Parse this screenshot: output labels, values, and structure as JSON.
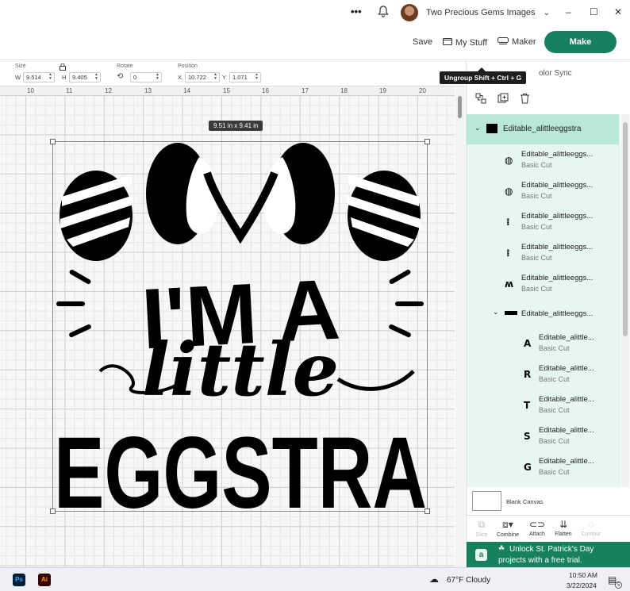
{
  "titlebar": {
    "user_name": "Two Precious Gems Images",
    "more_icon": "more-icon",
    "bell_icon": "bell-icon",
    "minimize": "–",
    "maximize": "☐",
    "close": "✕"
  },
  "header": {
    "save": "Save",
    "my_stuff": "My Stuff",
    "maker": "Maker",
    "make": "Make"
  },
  "toolbar": {
    "size_label": "Size",
    "w_label": "W",
    "w_value": "9.514",
    "h_label": "H",
    "h_value": "9.405",
    "rotate_label": "Rotate",
    "rotate_value": "0",
    "position_label": "Position",
    "x_label": "X",
    "x_value": "10.722",
    "y_label": "Y",
    "y_value": "1.071"
  },
  "ruler": [
    "10",
    "11",
    "12",
    "13",
    "14",
    "15",
    "16",
    "17",
    "18",
    "19",
    "20"
  ],
  "canvas": {
    "dimensions": "9.51  in x 9.41  in",
    "design_text": {
      "line1": "I'M A",
      "line2": "little",
      "line3": "EGGSTRA"
    }
  },
  "panel": {
    "tooltip": "Ungroup Shift + Ctrl + G",
    "tab_partial": "olor Sync",
    "group_name": "Editable_alittleeggstra",
    "layers": [
      {
        "name": "Editable_alittleeggs...",
        "sub": "Basic Cut",
        "glyph": "◍"
      },
      {
        "name": "Editable_alittleeggs...",
        "sub": "Basic Cut",
        "glyph": "◍"
      },
      {
        "name": "Editable_alittleeggs...",
        "sub": "Basic Cut",
        "glyph": "⁞"
      },
      {
        "name": "Editable_alittleeggs...",
        "sub": "Basic Cut",
        "glyph": "⁞"
      },
      {
        "name": "Editable_alittleeggs...",
        "sub": "Basic Cut",
        "glyph": "ʍ"
      }
    ],
    "subgroup_name": "Editable_alittleeggs...",
    "sublayers": [
      {
        "name": "Editable_alittle...",
        "sub": "Basic Cut",
        "glyph": "A"
      },
      {
        "name": "Editable_alittle...",
        "sub": "Basic Cut",
        "glyph": "R"
      },
      {
        "name": "Editable_alittle...",
        "sub": "Basic Cut",
        "glyph": "T"
      },
      {
        "name": "Editable_alittle...",
        "sub": "Basic Cut",
        "glyph": "S"
      },
      {
        "name": "Editable_alittle...",
        "sub": "Basic Cut",
        "glyph": "G"
      }
    ],
    "blank_canvas": "Blank Canvas",
    "actions": [
      "Slice",
      "Combine",
      "Attach",
      "Flatten",
      "Contour"
    ],
    "promo_line1": "Unlock St. Patrick's Day",
    "promo_line2": "projects with a free trial."
  },
  "taskbar": {
    "ps": "Ps",
    "ai": "Ai",
    "weather": "67°F  Cloudy",
    "time": "10:50 AM",
    "date": "3/22/2024",
    "notif": "5"
  },
  "colors": {
    "accent": "#168060",
    "layer_bg": "#e6f6f0",
    "layer_selected": "#b9e8d9"
  }
}
